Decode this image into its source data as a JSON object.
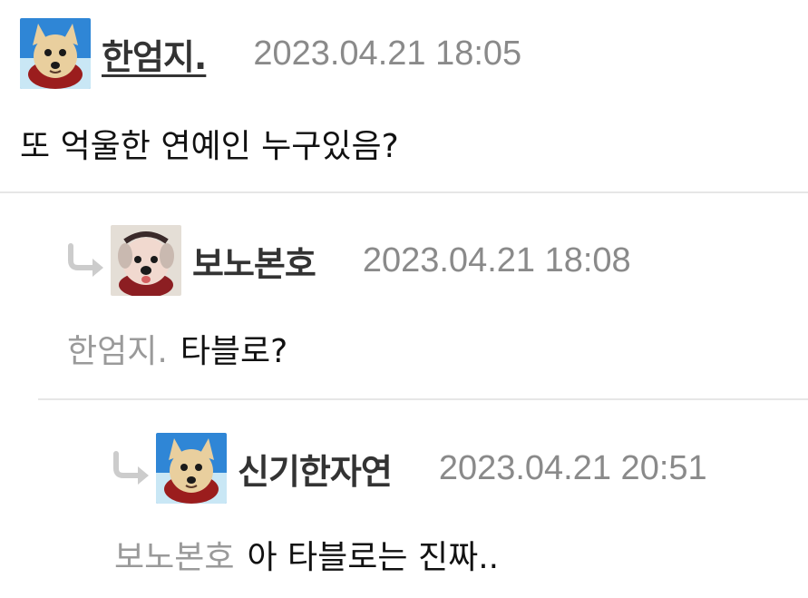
{
  "comments": [
    {
      "author": "한엄지.",
      "timestamp": "2023.04.21 18:05",
      "mention": "",
      "text": "또 억울한 연예인 누구있음?",
      "avatar_icon": "dog-avatar-icon"
    },
    {
      "author": "보노본호",
      "timestamp": "2023.04.21 18:08",
      "mention": "한엄지.",
      "text": "타블로?",
      "avatar_icon": "puppy-avatar-icon"
    },
    {
      "author": "신기한자연",
      "timestamp": "2023.04.21 20:51",
      "mention": "보노본호",
      "text": "아 타블로는 진짜..",
      "avatar_icon": "dog-avatar-icon"
    }
  ],
  "colors": {
    "author": "#333333",
    "timestamp": "#8a8a8a",
    "mention": "#9a9a9a",
    "text": "#111111",
    "divider": "#e6e6e6",
    "reply_arrow": "#cccccc"
  }
}
